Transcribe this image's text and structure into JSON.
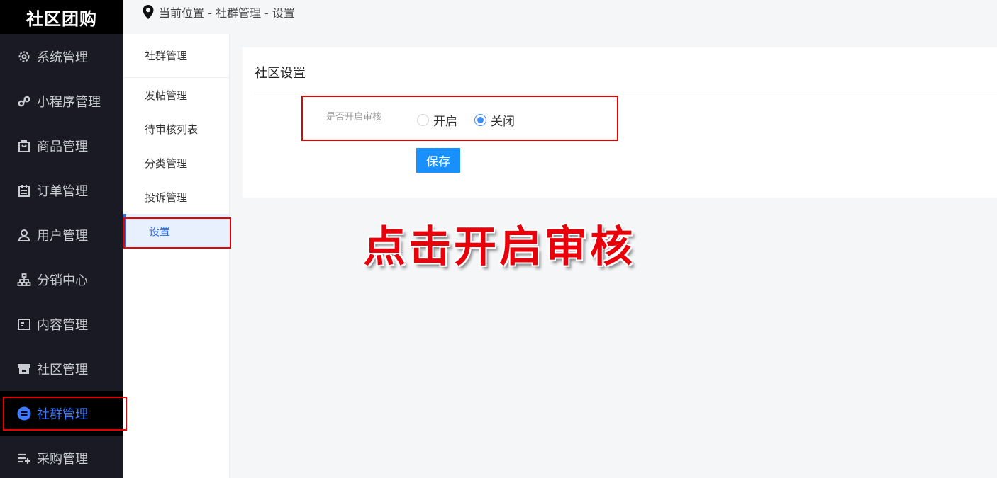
{
  "brand": "社区团购",
  "breadcrumb": "当前位置 - 社群管理 - 设置",
  "sidebar": {
    "items": [
      {
        "label": "系统管理",
        "icon": "gear-icon"
      },
      {
        "label": "小程序管理",
        "icon": "miniprogram-icon"
      },
      {
        "label": "商品管理",
        "icon": "shopping-bag-icon"
      },
      {
        "label": "订单管理",
        "icon": "clipboard-icon"
      },
      {
        "label": "用户管理",
        "icon": "user-icon"
      },
      {
        "label": "分销中心",
        "icon": "org-chart-icon"
      },
      {
        "label": "内容管理",
        "icon": "content-icon"
      },
      {
        "label": "社区管理",
        "icon": "store-icon"
      },
      {
        "label": "社群管理",
        "icon": "group-icon",
        "active": true
      },
      {
        "label": "采购管理",
        "icon": "list-add-icon"
      }
    ]
  },
  "submenu": {
    "title": "社群管理",
    "items": [
      "发帖管理",
      "待审核列表",
      "分类管理",
      "投诉管理",
      "设置"
    ],
    "active": "设置"
  },
  "panel": {
    "title": "社区设置",
    "field_label": "是否开启审核",
    "options": [
      {
        "label": "开启",
        "checked": false
      },
      {
        "label": "关闭",
        "checked": true
      }
    ],
    "save_label": "保存"
  },
  "annotation": {
    "callout_text": "点击开启审核",
    "color": "#e60000"
  },
  "colors": {
    "accent": "#1890ff",
    "sidebar_bg": "#191a23",
    "active_text": "#3f7bff"
  }
}
